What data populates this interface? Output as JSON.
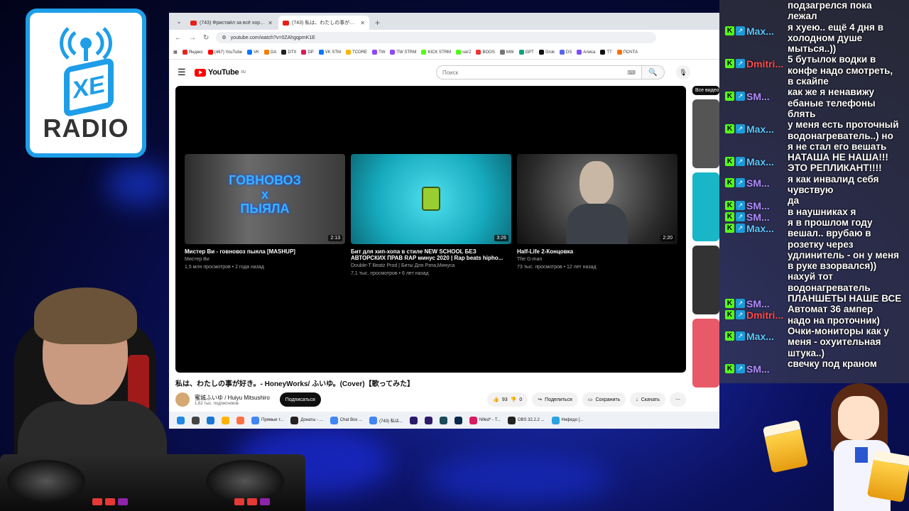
{
  "logo": {
    "badge": "XE",
    "word": "RADIO"
  },
  "browser": {
    "tabs": [
      {
        "title": "(743) Фристайл за всё хороше",
        "active": false
      },
      {
        "title": "(743) 私は、わたしの事が好き。- H",
        "active": true
      }
    ],
    "url": "youtube.com/watch?v=0ZAhgqpmK1E",
    "bookmarks": [
      {
        "label": "Яндекс",
        "color": "#e52620"
      },
      {
        "label": "(467) YouTube",
        "color": "#ff0000"
      },
      {
        "label": "VK",
        "color": "#0077ff"
      },
      {
        "label": "DA",
        "color": "#f57c00"
      },
      {
        "label": "DTX",
        "color": "#222222"
      },
      {
        "label": "DP",
        "color": "#d81b60"
      },
      {
        "label": "VK STM",
        "color": "#0077ff"
      },
      {
        "label": "TCORE",
        "color": "#ffb300"
      },
      {
        "label": "TW",
        "color": "#9146ff"
      },
      {
        "label": "TW STRM",
        "color": "#9146ff"
      },
      {
        "label": "KICK STRM",
        "color": "#53fc18"
      },
      {
        "label": "чат2",
        "color": "#53fc18"
      },
      {
        "label": "BOOS",
        "color": "#e53935"
      },
      {
        "label": "MW",
        "color": "#757575"
      },
      {
        "label": "GPT",
        "color": "#10a37f"
      },
      {
        "label": "Grok",
        "color": "#111111"
      },
      {
        "label": "DS",
        "color": "#5865f2"
      },
      {
        "label": "Алиса",
        "color": "#7c4dff"
      },
      {
        "label": "TT",
        "color": "#111111"
      },
      {
        "label": "ПОЧТА",
        "color": "#ff6f00"
      }
    ]
  },
  "youtube": {
    "logo_text": "YouTube",
    "logo_region": "RU",
    "search_placeholder": "Поиск",
    "side_chip": "Все видео",
    "end_cards": [
      {
        "title": "Мистер Ви - говновоз пыяла [MASHUP]",
        "channel": "Мистер Ви",
        "stats": "1,5 млн просмотров • 2 года назад",
        "duration": "2:13",
        "thumb_text": "ГОВНОВОЗ\nx\nПЫЯЛА"
      },
      {
        "title": "Бит для хип-хопа в стиле NEW SCHOOL БЕЗ АВТОРСКИХ ПРАВ RAP минус 2020 | Rap beats hipho...",
        "channel": "Double-T Beatz Prod | Биты Для Рэпа,Минуса",
        "stats": "7,1 тыс. просмотров • 6 лет назад",
        "duration": "3:26",
        "thumb_text": ""
      },
      {
        "title": "Half-Life 2-Концовка",
        "channel": "The G-man",
        "stats": "73 тыс. просмотров • 12 лет назад",
        "duration": "2:20",
        "thumb_text": ""
      }
    ],
    "video_title": "私は、わたしの事が好き。- HoneyWorks/ ふいゆ。(Cover)【歌ってみた】",
    "channel_name": "蜜城ふいゆ / Huiyu Mitsushiro",
    "channel_subs": "1,62 тыс. подписчиков",
    "subscribe_label": "Подписаться",
    "likes": "93",
    "dislikes": "0",
    "share_label": "Поделиться",
    "save_label": "Сохранить",
    "download_label": "Скачать"
  },
  "taskbar": [
    {
      "label": "Прямые т...",
      "color": "#4285f4"
    },
    {
      "label": "Донаты - ...",
      "color": "#222222"
    },
    {
      "label": "Chat Box ...",
      "color": "#4285f4"
    },
    {
      "label": "(743) 私は...",
      "color": "#4285f4"
    },
    {
      "label": "Nifed^ - T...",
      "color": "#d81b60"
    },
    {
      "label": "OBS 32.2.2 ...",
      "color": "#222222"
    },
    {
      "label": "Нифедо [...",
      "color": "#2aa3df"
    }
  ],
  "chat": {
    "users": [
      {
        "name": "Max...",
        "color": "#5bc8ff"
      },
      {
        "name": "Dmitri...",
        "color": "#ff4b4b"
      },
      {
        "name": "SM...",
        "color": "#b28cff"
      },
      {
        "name": "Max...",
        "color": "#5bc8ff"
      },
      {
        "name": "Max...",
        "color": "#5bc8ff"
      },
      {
        "name": "SM...",
        "color": "#b28cff"
      },
      {
        "name": "SM...",
        "color": "#b28cff"
      },
      {
        "name": "SM...",
        "color": "#b28cff"
      },
      {
        "name": "Max...",
        "color": "#5bc8ff"
      },
      {
        "name": "SM...",
        "color": "#b28cff"
      },
      {
        "name": "Dmitri...",
        "color": "#ff4b4b"
      },
      {
        "name": "Max...",
        "color": "#5bc8ff"
      },
      {
        "name": "SM...",
        "color": "#b28cff"
      }
    ],
    "lines": [
      "подзагрелся пока",
      "лежал",
      "я хуею.. ещё 4 дня в",
      "холодном душе",
      "мыться..))",
      "5 бутылок водки в",
      "конфе надо смотреть,",
      "в скайпе",
      "как же я ненавижу",
      "ебаные телефоны",
      "блять",
      "у меня есть проточный",
      "водонагреватель..) но",
      "я не стал его вешать",
      "НАТАША НЕ НАША!!!",
      "ЭТО РЕПЛИКАНТ!!!!",
      "я как инвалид себя",
      "чувствую",
      "да",
      "в наушниках я",
      "я в прошлом году",
      "вешал.. врубаю в",
      "розетку через",
      "удлинитель - он у меня",
      "в руке взорвался))",
      "нахуй тот",
      "водонагреватель",
      "ПЛАНШЕТЫ НАШЕ ВСЕ",
      "Автомат 36 ампер",
      "надо на проточник)",
      "Очки-мониторы как у",
      "меня - охуительная",
      "штука..)",
      "свечку под краном"
    ]
  }
}
